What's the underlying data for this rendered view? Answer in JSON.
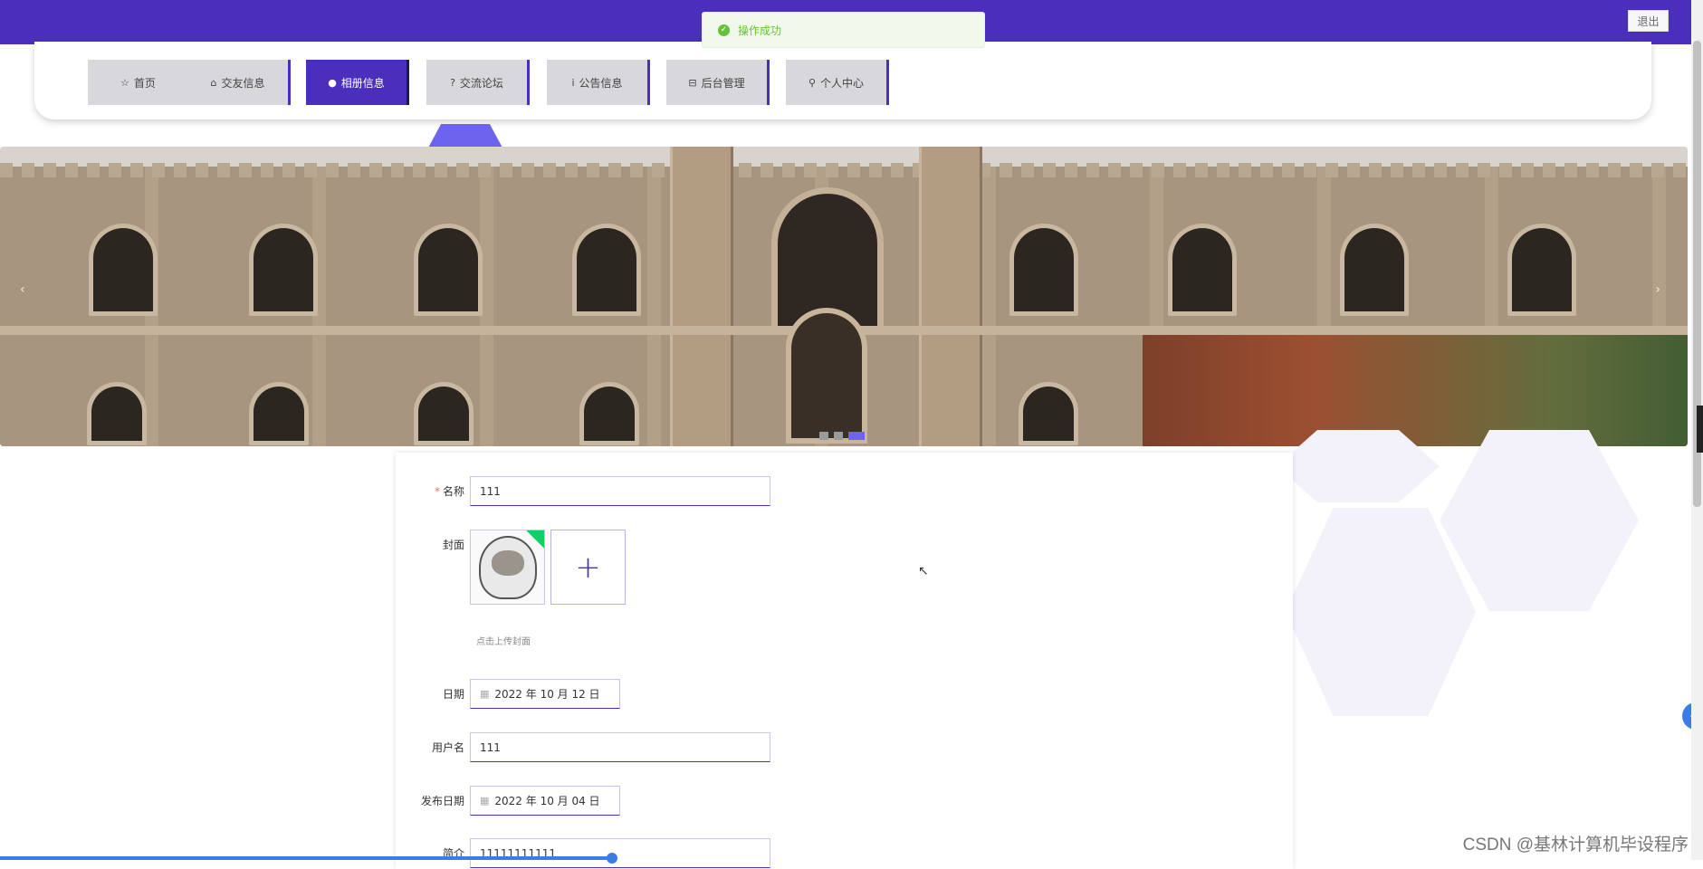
{
  "header": {
    "logout_label": "退出"
  },
  "toast": {
    "message": "操作成功"
  },
  "nav": {
    "items": [
      {
        "icon": "☆",
        "label": "首页"
      },
      {
        "icon": "⌂",
        "label": "交友信息"
      },
      {
        "icon": "●",
        "label": "相册信息"
      },
      {
        "icon": "?",
        "label": "交流论坛"
      },
      {
        "icon": "i",
        "label": "公告信息"
      },
      {
        "icon": "⊟",
        "label": "后台管理"
      },
      {
        "icon": "⚲",
        "label": "个人中心"
      }
    ],
    "active_index": 2
  },
  "carousel": {
    "prev_icon": "‹",
    "next_icon": "›",
    "active_slide": 3,
    "slide_count": 3
  },
  "form": {
    "name_label": "名称",
    "name_value": "111",
    "cover_label": "封面",
    "cover_hint": "点击上传封面",
    "add_symbol": "+",
    "date_label": "日期",
    "date_value": "2022 年 10 月 12 日",
    "username_label": "用户名",
    "username_value": "111",
    "publish_date_label": "发布日期",
    "publish_date_value": "2022 年 10 月 04 日",
    "intro_label": "简介",
    "intro_value": "11111111111"
  },
  "side_button_icon": "‹",
  "watermark": "CSDN @基林计算机毕设程序",
  "colors": {
    "primary": "#4a2fbd",
    "accent": "#6e63ee",
    "success": "#67c23a"
  }
}
